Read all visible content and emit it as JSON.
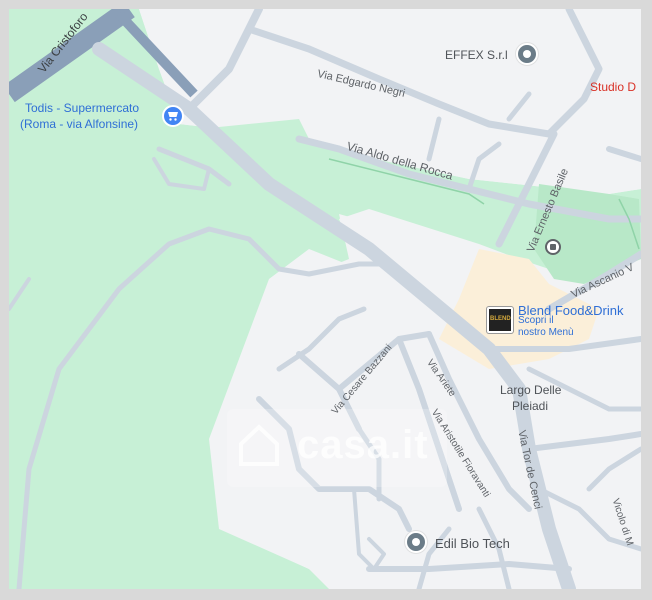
{
  "map": {
    "watermark": "casa.it",
    "streets": {
      "via_cristoforo": "Via Cristoforo",
      "via_edgardo_negri": "Via Edgardo Negri",
      "via_aldo_della_rocca": "Via Aldo della Rocca",
      "via_ernesto_basile": "Via Ernesto Basile",
      "via_ascanio": "Via Ascanio V",
      "via_cesare_bazzani": "Via Cesare Bazzani",
      "via_ariete": "Via Ariete",
      "via_aristotile_fioravanti": "Via Aristotile Fioravanti",
      "via_tor_de_cenci": "Via Tor de Cenci",
      "vicolo": "Vicolo di M"
    },
    "places": {
      "largo_line1": "Largo Delle",
      "largo_line2": "Pleiadi"
    },
    "pois": {
      "todis_line1": "Todis - Supermercato",
      "todis_line2": "(Roma - via Alfonsine)",
      "effex": "EFFEX S.r.l",
      "studio": "Studio D",
      "blend_name": "Blend Food&Drink",
      "blend_sub1": "Scopri il",
      "blend_sub2": "nostro Menù",
      "blend_logo": "BLEND",
      "edil": "Edil Bio Tech"
    },
    "colors": {
      "park": "#c7f0d6",
      "land": "#f2f3f5",
      "road": "#ccd5df",
      "highway": "#8a9fb8",
      "commercial": "#fbefd9",
      "poi_blue": "#2f6fd6",
      "poi_red": "#d93025"
    }
  }
}
